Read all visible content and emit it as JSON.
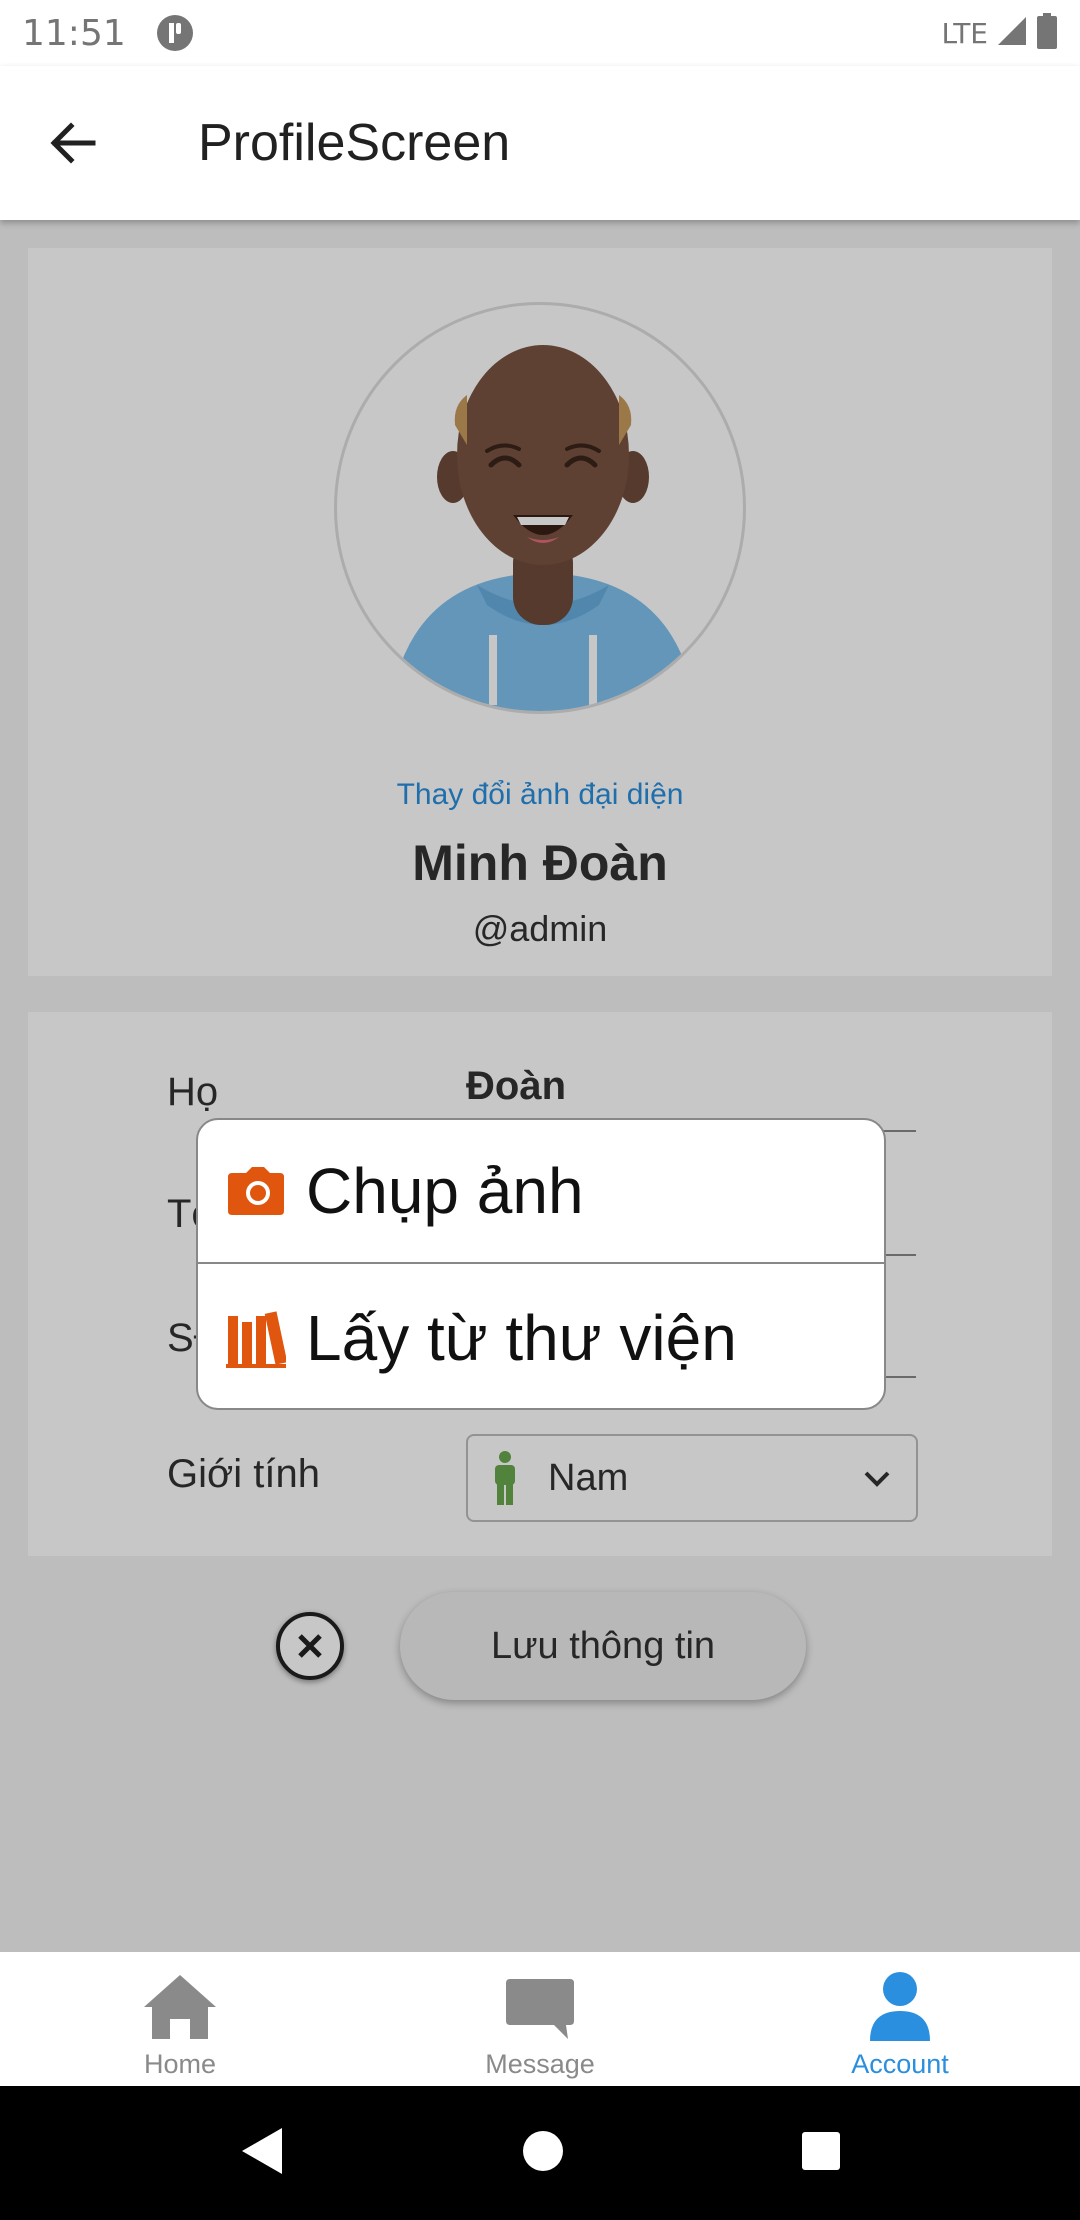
{
  "status_bar": {
    "time": "11:51",
    "network": "LTE"
  },
  "app_bar": {
    "title": "ProfileScreen"
  },
  "profile": {
    "change_avatar_label": "Thay đổi ảnh đại diện",
    "full_name": "Minh Đoàn",
    "username": "@admin"
  },
  "form": {
    "last_name_label": "Họ",
    "last_name_value": "Đoàn",
    "first_name_label": "Tên",
    "phone_label": "SĐT",
    "gender_label": "Giới tính",
    "gender_value": "Nam"
  },
  "actions": {
    "save_label": "Lưu thông tin"
  },
  "popup": {
    "items": [
      {
        "label": "Chụp ảnh",
        "icon": "camera-icon"
      },
      {
        "label": "Lấy từ thư viện",
        "icon": "library-icon"
      }
    ]
  },
  "bottom_nav": {
    "items": [
      {
        "label": "Home",
        "icon": "home-icon",
        "active": false
      },
      {
        "label": "Message",
        "icon": "message-icon",
        "active": false
      },
      {
        "label": "Account",
        "icon": "account-icon",
        "active": true
      }
    ]
  },
  "colors": {
    "accent": "#2a8fde",
    "popup_icon": "#e0560f",
    "gender_icon": "#6aa84f"
  }
}
